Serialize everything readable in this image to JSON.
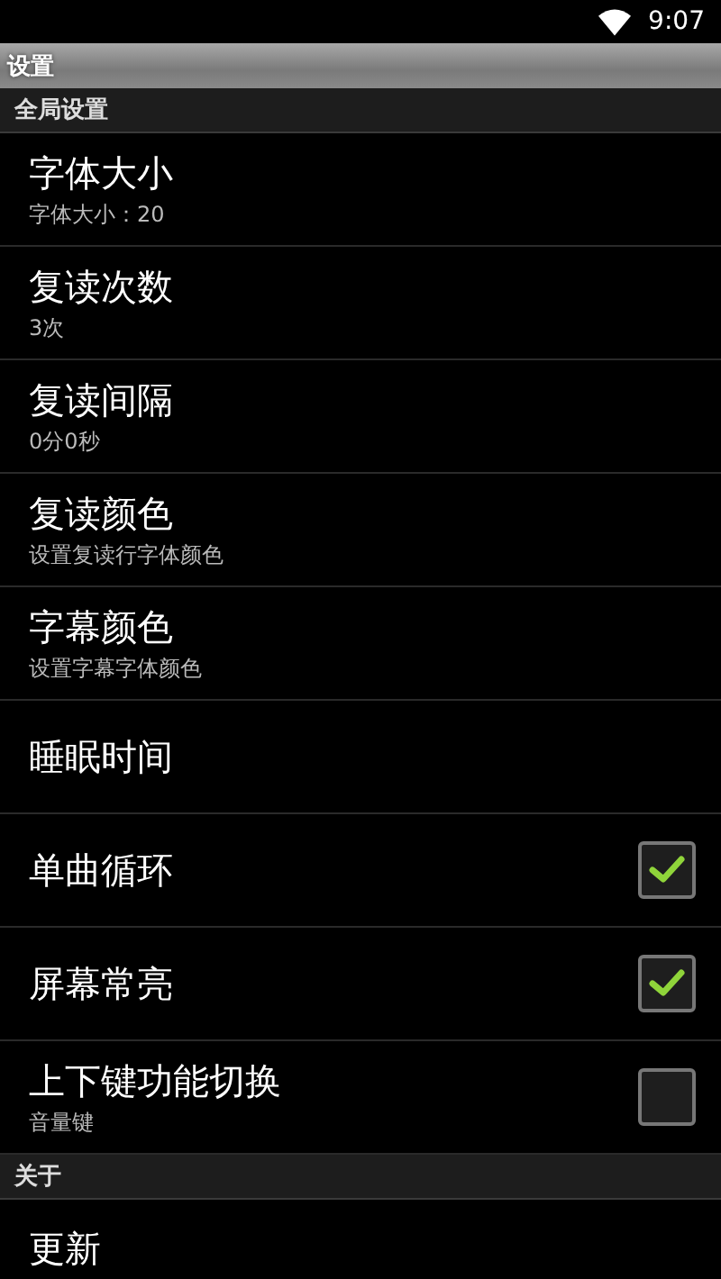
{
  "status_bar": {
    "time": "9:07"
  },
  "title": "设置",
  "sections": [
    {
      "header": "全局设置",
      "items": [
        {
          "kind": "text",
          "title": "字体大小",
          "summary": "字体大小：20"
        },
        {
          "kind": "text",
          "title": "复读次数",
          "summary": "3次"
        },
        {
          "kind": "text",
          "title": "复读间隔",
          "summary": "0分0秒"
        },
        {
          "kind": "text",
          "title": "复读颜色",
          "summary": "设置复读行字体颜色"
        },
        {
          "kind": "text",
          "title": "字幕颜色",
          "summary": "设置字幕字体颜色"
        },
        {
          "kind": "text",
          "title": "睡眠时间"
        },
        {
          "kind": "checkbox",
          "title": "单曲循环",
          "checked": true
        },
        {
          "kind": "checkbox",
          "title": "屏幕常亮",
          "checked": true
        },
        {
          "kind": "checkbox",
          "title": "上下键功能切换",
          "summary": "音量键",
          "checked": false
        }
      ]
    },
    {
      "header": "关于",
      "items": [
        {
          "kind": "text",
          "title": "更新"
        }
      ]
    }
  ]
}
